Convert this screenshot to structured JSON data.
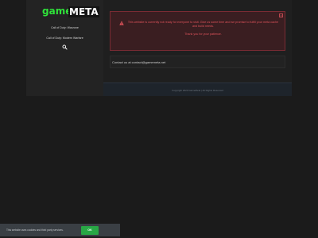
{
  "header": {
    "logo_game": "game",
    "logo_meta": "META"
  },
  "sidebar": {
    "items": [
      {
        "label": "Call of Duty: Warzone"
      },
      {
        "label": "Call of Duty: Modern Warfare"
      }
    ],
    "search_icon": "search-icon"
  },
  "alert": {
    "icon": "warning-triangle-icon",
    "close_label": "×",
    "message": "This website is currently not ready for everyone to visit. Give us some time and we promise to fulfill your meta cache and build needs.",
    "thanks": "Thank you for your patience."
  },
  "contact": {
    "text": "Contact us at contact@gamemeta.net"
  },
  "footer": {
    "copyright": "Copyright 2020 GameMeta  |  All Rights Reserved"
  },
  "cookie": {
    "text": "This website uses cookies and third party services.",
    "ok_label": "OK"
  },
  "colors": {
    "brand_green": "#2fe23a",
    "alert_red": "#e0535b",
    "ok_green": "#28a745"
  }
}
